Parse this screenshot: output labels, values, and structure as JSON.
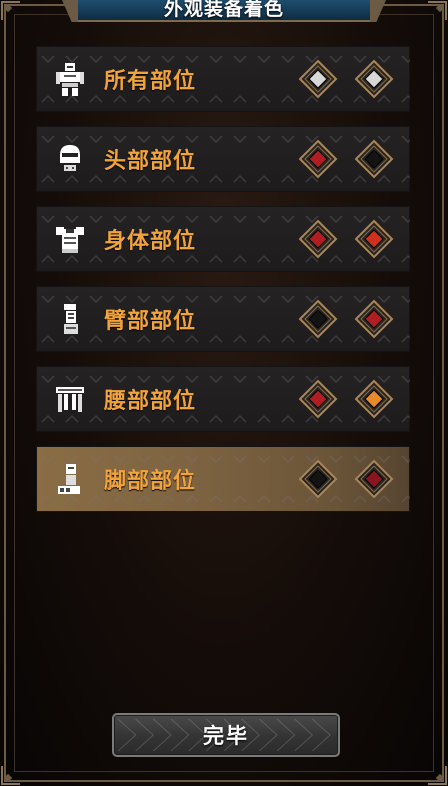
{
  "title": "外观装备着色",
  "rows": [
    {
      "label": "所有部位",
      "icon": "full-armor-icon",
      "color1": "#d8d8d8",
      "color2": "#d8d8d8",
      "selected": false
    },
    {
      "label": "头部部位",
      "icon": "helmet-icon",
      "color1": "#b01e24",
      "color2": "#141414",
      "selected": false
    },
    {
      "label": "身体部位",
      "icon": "chest-armor-icon",
      "color1": "#b01e24",
      "color2": "#d0301e",
      "selected": false
    },
    {
      "label": "臂部部位",
      "icon": "arm-armor-icon",
      "color1": "#141414",
      "color2": "#b01e24",
      "selected": false
    },
    {
      "label": "腰部部位",
      "icon": "waist-armor-icon",
      "color1": "#b01e24",
      "color2": "#e8892a",
      "selected": false
    },
    {
      "label": "脚部部位",
      "icon": "leg-armor-icon",
      "color1": "#141414",
      "color2": "#8a1420",
      "selected": true
    }
  ],
  "done_button": {
    "label": "完毕"
  },
  "colors": {
    "label_orange": "#f2a33b",
    "swatch_border": "#a8865a",
    "title_blue": "#1e4d6e"
  }
}
